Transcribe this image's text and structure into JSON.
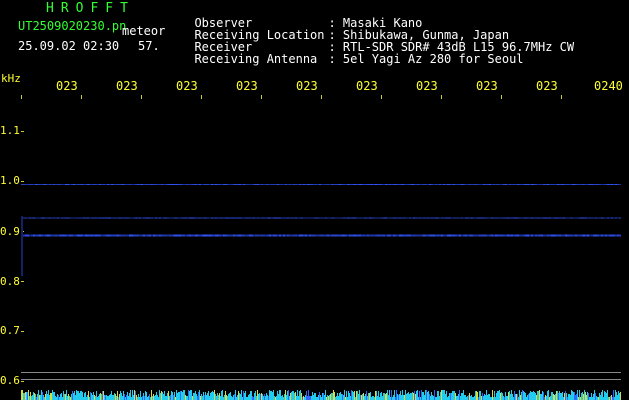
{
  "header": {
    "app_title": "HROFFT",
    "file_name": "UT2509020230.pn",
    "meteor_label": "meteor",
    "datetime": "25.09.02 02:30",
    "count": "57."
  },
  "meta": [
    {
      "label": "Observer",
      "value": ": Masaki Kano"
    },
    {
      "label": "Receiving Location",
      "value": ": Shibukawa, Gunma, Japan"
    },
    {
      "label": "Receiver",
      "value": ": RTL-SDR SDR# 43dB L15 96.7MHz CW"
    },
    {
      "label": "Receiving Antenna",
      "value": ": 5el Yagi Az 280 for Seoul"
    }
  ],
  "unit_label": "kHz",
  "time_axis": [
    "023",
    "023",
    "023",
    "023",
    "023",
    "023",
    "023",
    "023",
    "023",
    "0240"
  ],
  "freq_axis": [
    "1.1",
    "1.0",
    "0.9",
    "0.8",
    "0.7",
    "0.6"
  ],
  "colors": {
    "green": "#33ff33",
    "yellow": "#ffff33",
    "white": "#ffffff",
    "signal_blue": "#3355ff",
    "spectrum_cyan": "#22ccee",
    "background": "#000000"
  },
  "chart_data": {
    "type": "heatmap",
    "x_range_min": [
      30,
      40
    ],
    "y_range_khz": [
      0.59,
      1.15
    ],
    "signal_lines_khz": [
      0.994,
      0.927,
      0.893
    ],
    "reference_lines_khz": [
      0.618,
      0.604
    ]
  }
}
